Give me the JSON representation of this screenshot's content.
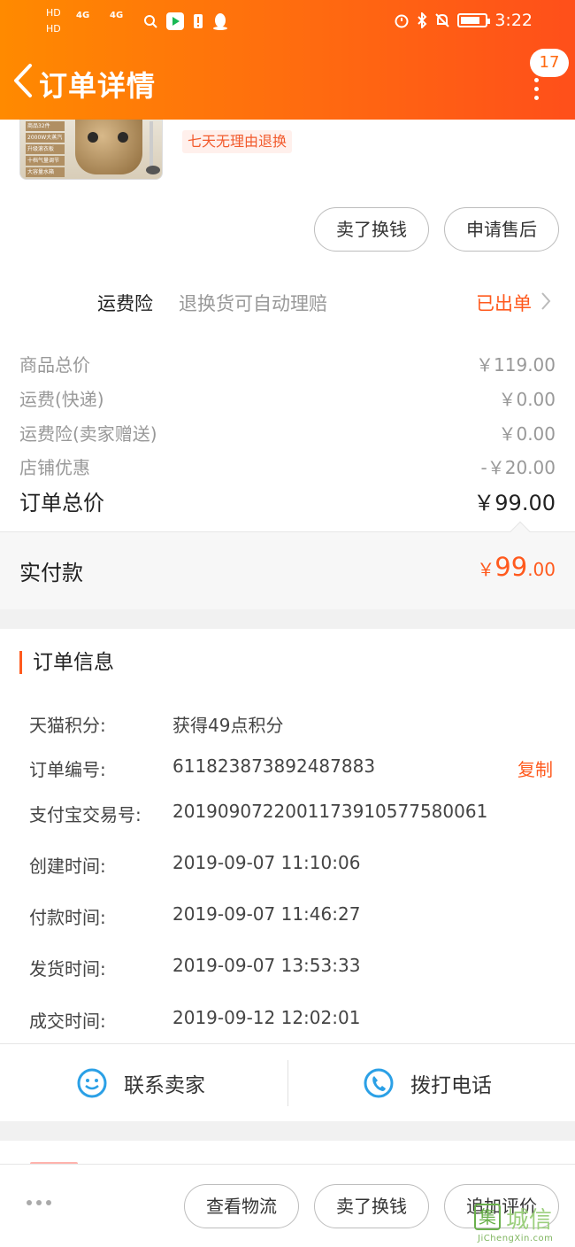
{
  "status_bar": {
    "network_1": "HD",
    "network_2": "HD",
    "signal_1": "4G",
    "signal_2": "4G",
    "time": "3:22"
  },
  "header": {
    "title": "订单详情",
    "badge_count": "17"
  },
  "product": {
    "tag": "七天无理由退换",
    "img_chips": [
      "商品32件",
      "2000W大蒸汽",
      "升级滚衣板",
      "十档气量调节",
      "大容量水箱"
    ]
  },
  "item_actions": {
    "sell_label": "卖了换钱",
    "aftersale_label": "申请售后"
  },
  "shipping_insurance": {
    "label": "运费险",
    "description": "退换货可自动理赔",
    "status": "已出单"
  },
  "price_rows": [
    {
      "label": "商品总价",
      "value": "￥119.00"
    },
    {
      "label": "运费(快递)",
      "value": "￥0.00"
    },
    {
      "label": "运费险(卖家赠送)",
      "value": "￥0.00"
    },
    {
      "label": "店铺优惠",
      "value": "-￥20.00"
    }
  ],
  "order_total": {
    "label": "订单总价",
    "value": "￥99.00"
  },
  "paid": {
    "label": "实付款",
    "currency": "￥",
    "integer": "99",
    "decimal": ".00"
  },
  "order_info": {
    "title": "订单信息",
    "rows": [
      {
        "label": "天猫积分:",
        "value": "获得49点积分"
      },
      {
        "label": "订单编号:",
        "value": "611823873892487883"
      },
      {
        "label": "支付宝交易号:",
        "value": "2019090722001173910577580061"
      },
      {
        "label": "创建时间:",
        "value": "2019-09-07 11:10:06"
      },
      {
        "label": "付款时间:",
        "value": "2019-09-07 11:46:27"
      },
      {
        "label": "发货时间:",
        "value": "2019-09-07 13:53:33"
      },
      {
        "label": "成交时间:",
        "value": "2019-09-12 12:02:01"
      }
    ],
    "copy_label": "复制"
  },
  "contact": {
    "seller_label": "联系卖家",
    "phone_label": "拨打电话"
  },
  "bottom_actions": {
    "logistics_label": "查看物流",
    "sell_label": "卖了换钱",
    "review_label": "追加评价"
  },
  "watermark": {
    "mark": "集",
    "text": "城信",
    "sub": "JiChengXin.com"
  },
  "colors": {
    "header_start": "#ff8a00",
    "header_end": "#ff4f1a",
    "accent": "#ff5a1e",
    "contact_icon": "#2ba0e6"
  }
}
